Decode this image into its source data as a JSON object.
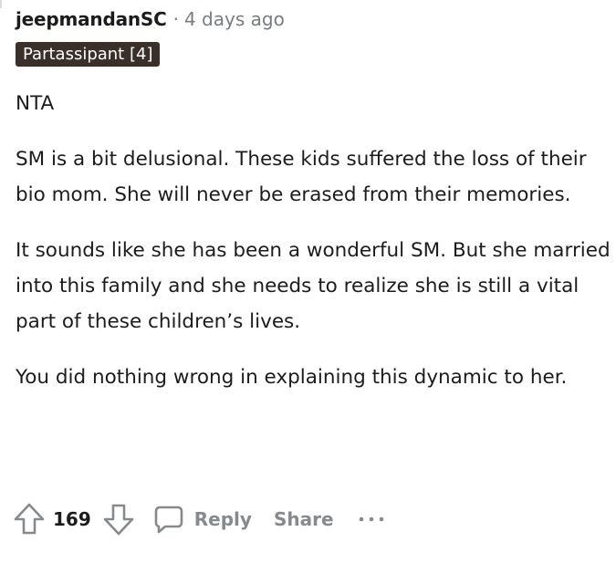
{
  "comment": {
    "author": "jeepmandanSC",
    "separator": "·",
    "timestamp": "4 days ago",
    "flair": "Partassipant [4]",
    "paragraphs": [
      "NTA",
      "SM is a bit delusional. These kids suffered the loss of their bio mom. She will never be erased from their memories.",
      "It sounds like she has been a wonderful SM. But she married into this family and she needs to realize she is still a vital part of these children’s lives.",
      "You did nothing wrong in explaining this dynamic to her."
    ]
  },
  "actions": {
    "vote_count": "169",
    "reply_label": "Reply",
    "share_label": "Share",
    "upvote_icon": "upvote-arrow-icon",
    "downvote_icon": "downvote-arrow-icon",
    "reply_icon": "speech-bubble-icon",
    "more_icon": "ellipsis-icon"
  },
  "colors": {
    "text": "#1c1c1c",
    "muted": "#787c7e",
    "action": "#878a8c",
    "flair_bg": "#3b2f2a",
    "flair_text": "#ffffff"
  }
}
